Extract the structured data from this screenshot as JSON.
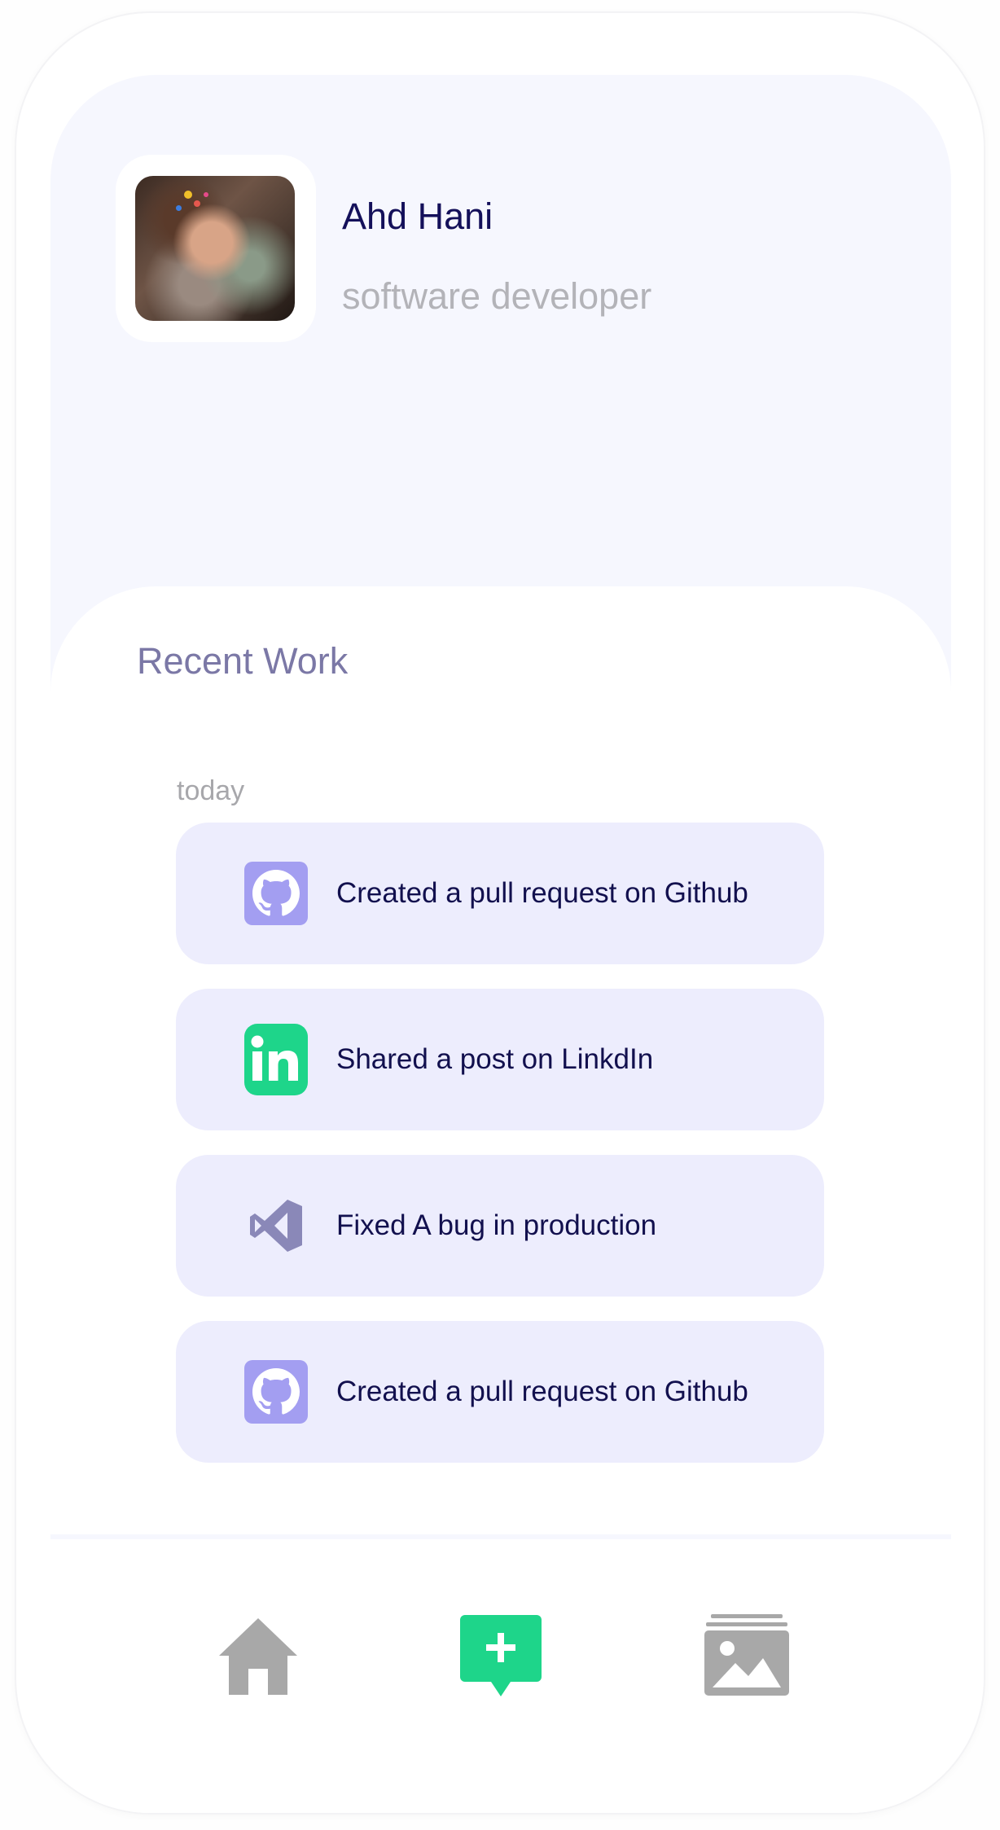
{
  "profile": {
    "name": "Ahd Hani",
    "role": "software developer"
  },
  "recent_work": {
    "title": "Recent Work",
    "date_label": "today",
    "items": [
      {
        "icon": "github-icon",
        "label": "Created a pull request on Github"
      },
      {
        "icon": "linkedin-icon",
        "label": "Shared a post on LinkdIn"
      },
      {
        "icon": "vscode-icon",
        "label": "Fixed A bug in production"
      },
      {
        "icon": "github-icon",
        "label": "Created a pull request on Github"
      }
    ]
  },
  "bottom_nav": {
    "items": [
      {
        "icon": "home-icon",
        "active": false
      },
      {
        "icon": "add-post-icon",
        "active": true
      },
      {
        "icon": "gallery-icon",
        "active": false
      }
    ]
  },
  "colors": {
    "accent_green": "#1ed58a",
    "github_purple": "#a39ef1",
    "heading_dark": "#14105a",
    "muted_purple": "#7b78a6",
    "inactive_gray": "#a8a8a8"
  }
}
